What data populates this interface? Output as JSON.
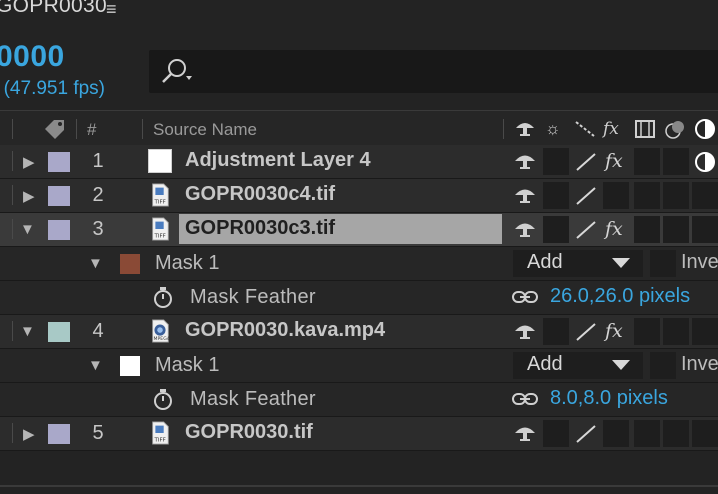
{
  "comp": {
    "tab_title": "GOPR0030",
    "menu_glyph": "≡",
    "timecode": "0000",
    "fps": ") (47.951 fps)"
  },
  "columns": {
    "number": "#",
    "source_name": "Source Name"
  },
  "layers": [
    {
      "number": "1",
      "name": "Adjustment Layer 4",
      "label_color": "#a9a8c9",
      "type": "solid",
      "expanded": false,
      "fx": true
    },
    {
      "number": "2",
      "name": "GOPR0030c4.tif",
      "label_color": "#a9a8c9",
      "type": "tiff",
      "expanded": false,
      "fx": false
    },
    {
      "number": "3",
      "name": "GOPR0030c3.tif",
      "label_color": "#a9a8c9",
      "type": "tiff",
      "expanded": true,
      "selected": true,
      "fx": true
    },
    {
      "number": "4",
      "name": "GOPR0030.kava.mp4",
      "label_color": "#a8c9c6",
      "type": "video",
      "expanded": true,
      "fx": true
    },
    {
      "number": "5",
      "name": "GOPR0030.tif",
      "label_color": "#a9a8c9",
      "type": "tiff",
      "expanded": false,
      "fx": false
    }
  ],
  "masks": [
    {
      "name": "Mask 1",
      "color": "#8a4a36",
      "mode": "Add",
      "invert_label": "Inve",
      "property": "Mask Feather",
      "feather_value": "26.0,26.0 pixels"
    },
    {
      "name": "Mask 1",
      "color": "#ffffff",
      "mode": "Add",
      "invert_label": "Inve",
      "property": "Mask Feather",
      "feather_value": "8.0,8.0 pixels"
    }
  ],
  "colors": {
    "accent": "#3aa6df",
    "panel_bg": "#232323",
    "selection": "#a6a6a6"
  }
}
